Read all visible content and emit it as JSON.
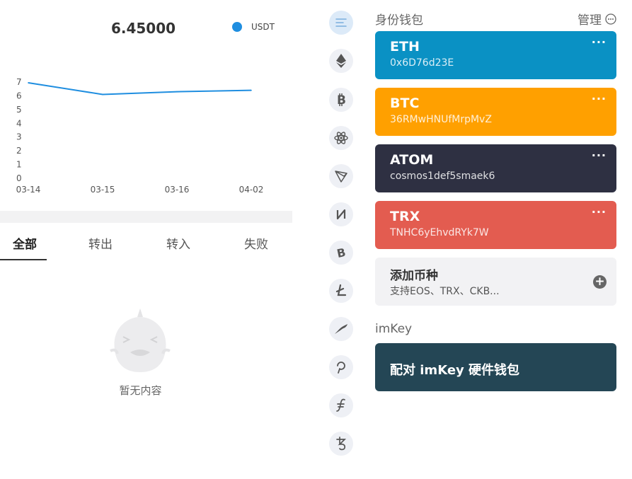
{
  "chart": {
    "balance": "6.45000",
    "legend": "USDT"
  },
  "chart_data": {
    "type": "line",
    "categories": [
      "03-14",
      "03-15",
      "03-16",
      "04-02"
    ],
    "series": [
      {
        "name": "USDT",
        "values": [
          6.95,
          6.1,
          6.3,
          6.4
        ]
      }
    ],
    "ylim": [
      0,
      7
    ],
    "yticks": [
      "0",
      "1",
      "2",
      "3",
      "4",
      "5",
      "6",
      "7"
    ],
    "color": "#1f8ee0"
  },
  "tabs": [
    {
      "label": "全部"
    },
    {
      "label": "转出"
    },
    {
      "label": "转入"
    },
    {
      "label": "失败"
    }
  ],
  "empty": {
    "text": "暂无内容",
    "icon": "empty-ghost-icon"
  },
  "rail": [
    {
      "icon": "menu-icon"
    },
    {
      "icon": "eth-icon"
    },
    {
      "icon": "btc-icon"
    },
    {
      "icon": "atom-icon"
    },
    {
      "icon": "trx-icon"
    },
    {
      "icon": "nervos-icon"
    },
    {
      "icon": "bch-icon"
    },
    {
      "icon": "ltc-icon"
    },
    {
      "icon": "kusama-icon"
    },
    {
      "icon": "polkadot-icon"
    },
    {
      "icon": "filecoin-icon"
    },
    {
      "icon": "tezos-icon"
    }
  ],
  "wallet": {
    "title": "身份钱包",
    "manage": "管理",
    "more": "···",
    "cards": [
      {
        "name": "ETH",
        "address": "0x6D76d23E",
        "color": "#0a91c4"
      },
      {
        "name": "BTC",
        "address": "36RMwHNUfMrpMvZ",
        "color": "#ffa000"
      },
      {
        "name": "ATOM",
        "address": "cosmos1def5smaek6",
        "color": "#2e3042"
      },
      {
        "name": "TRX",
        "address": "TNHC6yEhvdRYk7W",
        "color": "#e35c50"
      }
    ],
    "add": {
      "title": "添加币种",
      "subtitle": "支持EOS、TRX、CKB...",
      "icon": "+"
    }
  },
  "imkey": {
    "title": "imKey",
    "pair": "配对 imKey 硬件钱包"
  }
}
